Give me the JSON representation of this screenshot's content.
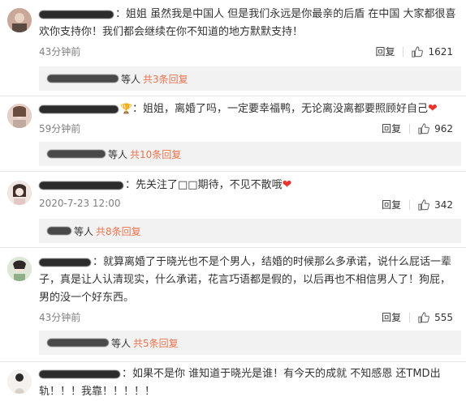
{
  "comments": [
    {
      "text": "：姐姐 虽然我是中国人 但是我们永远是你最亲的后盾 在中国 大家都很喜欢你支持你！我们都会继续在你不知道的地方默默支持！",
      "time": "43分钟前",
      "reply_label": "回复",
      "likes": "1621",
      "sub_people": "等人",
      "sub_link": "共3条回复"
    },
    {
      "text": "：姐姐，离婚了吗，一定要幸福鸭，无论离没离都要照顾好自己",
      "time": "59分钟前",
      "reply_label": "回复",
      "likes": "962",
      "sub_people": "等人",
      "sub_link": "共10条回复"
    },
    {
      "text": "：先关注了□□期待，不见不散哦",
      "time": "2020-7-23 12:00",
      "reply_label": "回复",
      "likes": "342",
      "sub_people": "等人",
      "sub_link": "共8条回复"
    },
    {
      "text": "：就算离婚了于晓光也不是个男人，结婚的时候那么多承诺，说什么屁话一辈子，真是让人认清现实，什么承诺，花言巧语都是假的，以后再也不相信男人了！狗屁，男的没一个好东西。",
      "time": "43分钟前",
      "reply_label": "回复",
      "likes": "555",
      "sub_people": "等人",
      "sub_link": "共5条回复"
    },
    {
      "text": "：如果不是你 谁知道于晓光是谁！有今天的成就 不知感恩 还TMD出轨！！！我靠！！！！！"
    }
  ],
  "icons": {
    "like": "thumbs-up-icon",
    "heart": "red-heart-icon",
    "badge": "trophy-icon"
  },
  "colors": {
    "link": "#eb7350",
    "time": "#808080",
    "subbg": "#f2f2f2"
  }
}
